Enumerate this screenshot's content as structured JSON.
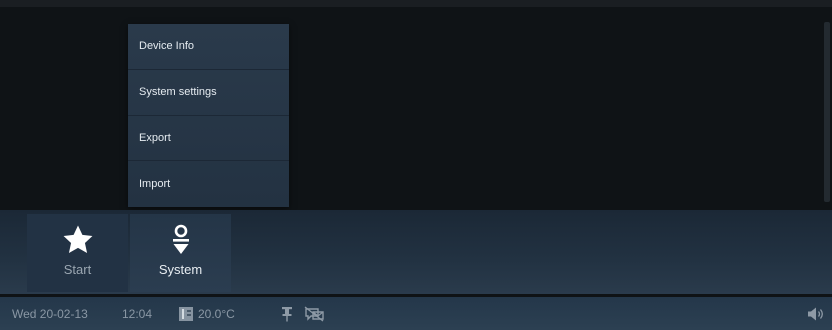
{
  "menu": {
    "items": [
      {
        "label": "Device Info"
      },
      {
        "label": "System settings"
      },
      {
        "label": "Export"
      },
      {
        "label": "Import"
      }
    ]
  },
  "dock": {
    "tiles": [
      {
        "label": "Start",
        "icon": "star-icon"
      },
      {
        "label": "System",
        "icon": "system-icon"
      }
    ]
  },
  "status": {
    "date": "Wed 20-02-13",
    "time": "12:04",
    "temperature": "20.0°C",
    "icons": [
      "thermometer-icon",
      "pin-icon",
      "no-messages-icon",
      "speaker-icon"
    ]
  },
  "colors": {
    "menu_bg": "#273748",
    "dock_bg": "#223242",
    "status_bg": "#283c4e",
    "text_dim": "#8a97a4"
  }
}
